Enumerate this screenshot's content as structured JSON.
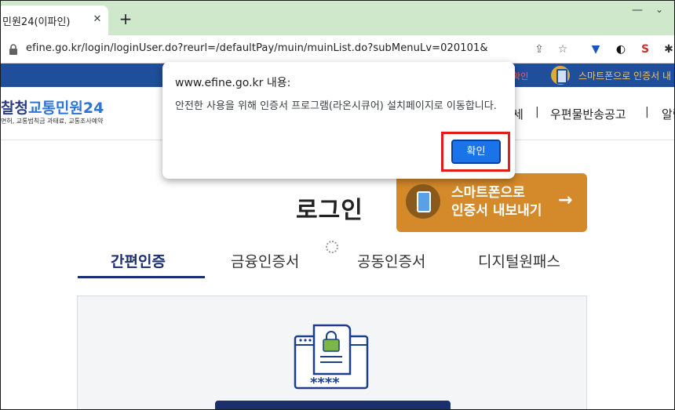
{
  "browser": {
    "tab_title": "민원24(이파인)",
    "tab_close": "✕",
    "new_tab": "+",
    "url": "efine.go.kr/login/loginUser.do?reurl=/defaultPay/muin/muinList.do?subMenuLv=020101&"
  },
  "site": {
    "topbar_red": "확인",
    "topbar_smart": "스마트폰으로 인증서 내",
    "logo_left": "찰청",
    "logo_right": "교통민원24",
    "logo_sub": "면허, 교통범칙금 과태료, 교통조사예약",
    "nav_item_1": "세",
    "nav_item_2": "우편물반송공고",
    "nav_item_3": "알림",
    "login_title": "로그인",
    "export_button": "스마트폰으로\n인증서 내보내기",
    "tabs": [
      "간편인증",
      "금융인증서",
      "공동인증서",
      "디지털원패스"
    ],
    "panel_masked": "****"
  },
  "dialog": {
    "title": "www.efine.go.kr 내용:",
    "message": "안전한 사용을 위해 인증서 프로그램(라온시큐어) 설치페이지로 이동합니다.",
    "ok_label": "확인"
  },
  "colors": {
    "tabstrip_bg": "#cfe8cc",
    "site_topbar": "#1f4e9b",
    "export_button": "#d4892a",
    "active_tab": "#1b2f6e",
    "ok_button": "#1a73e8",
    "highlight_box": "#e21b1b"
  }
}
